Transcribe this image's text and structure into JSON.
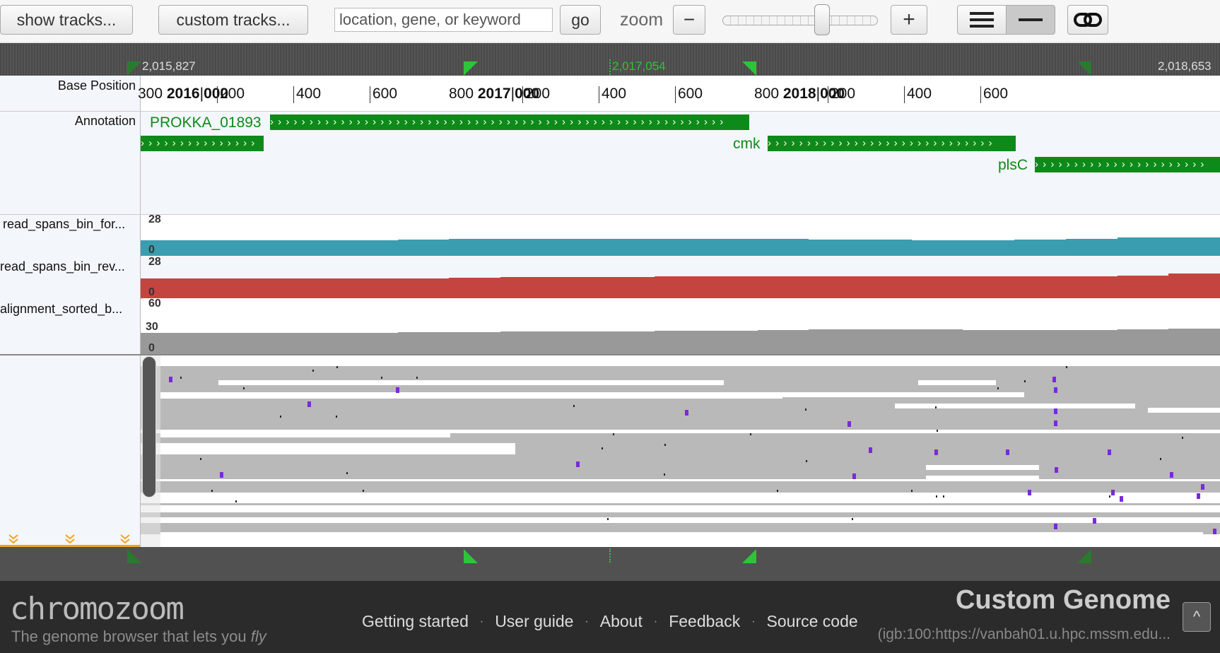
{
  "toolbar": {
    "show_tracks": "show tracks...",
    "custom_tracks": "custom tracks...",
    "search_placeholder": "location, gene, or keyword",
    "go": "go",
    "zoom_label": "zoom",
    "zoom_out": "−",
    "zoom_in": "+",
    "zoom_level": 0.64
  },
  "ruler": {
    "left_position": "2,015,827",
    "center_position": "2,017,054",
    "right_position": "2,018,653"
  },
  "axis": {
    "track_label": "Base Position",
    "ticks": [
      {
        "small": "300",
        "major": "2016",
        "suffix": "000"
      },
      {
        "small": "200"
      },
      {
        "small": "400"
      },
      {
        "small": "600"
      },
      {
        "small": "800",
        "major": "2017",
        "suffix": "000"
      },
      {
        "small": "200"
      },
      {
        "small": "400"
      },
      {
        "small": "600"
      },
      {
        "small": "800",
        "major": "2018",
        "suffix": "000"
      },
      {
        "small": "200"
      },
      {
        "small": "400"
      },
      {
        "small": "600"
      }
    ]
  },
  "tracks": {
    "annotation": {
      "label": "Annotation",
      "features": [
        {
          "name": "PROKKA_01893"
        },
        {
          "name": ""
        },
        {
          "name": "cmk"
        },
        {
          "name": "plsC"
        }
      ]
    },
    "forward": {
      "label": "read_spans_bin_for...",
      "max": "28",
      "min": "0",
      "color": "#3a9db0"
    },
    "reverse": {
      "label": "read_spans_bin_rev...",
      "max": "28",
      "min": "0",
      "color": "#c4443f"
    },
    "alignment": {
      "label": "alignment_sorted_b...",
      "max": "60",
      "mid": "30",
      "min": "0",
      "color": "#999999"
    }
  },
  "footer": {
    "logo": "chromozoom",
    "tagline": "The genome browser that lets you",
    "tagline_em": "fly",
    "links": [
      "Getting started",
      "User guide",
      "About",
      "Feedback",
      "Source code"
    ],
    "genome_title": "Custom Genome",
    "genome_source": "(igb:100:https://vanbah01.u.hpc.mssm.edu...",
    "collapse": "^"
  },
  "colors": {
    "accent_green": "#0e8a1a",
    "forward": "#3a9db0",
    "reverse": "#c4443f"
  }
}
